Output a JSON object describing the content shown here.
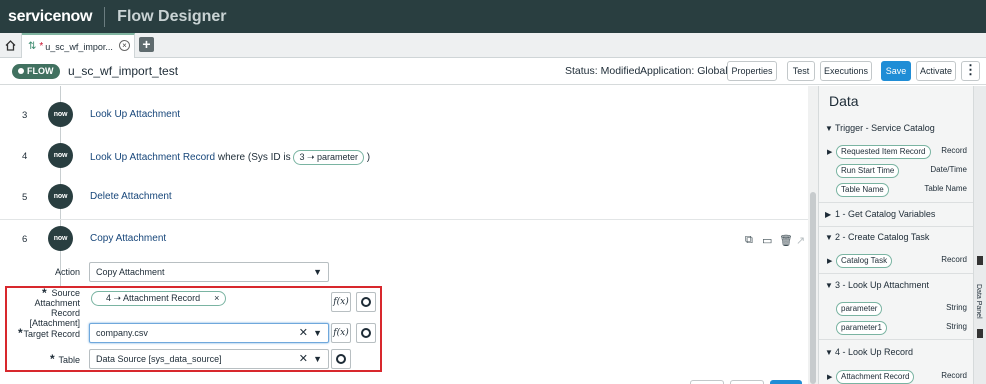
{
  "header": {
    "logo": "servicenow",
    "app_title": "Flow Designer"
  },
  "tabs": {
    "home_icon": "home-icon",
    "active_tab": {
      "label": "u_sc_wf_impor...",
      "dirty_marker": "*"
    }
  },
  "toolbar": {
    "badge": "FLOW",
    "flow_name": "u_sc_wf_import_test",
    "status": "Status: Modified",
    "application": "Application: Global",
    "buttons": {
      "properties": "Properties",
      "test": "Test",
      "executions": "Executions",
      "save": "Save",
      "activate": "Activate",
      "more": "⋮"
    }
  },
  "steps": [
    {
      "num": "3",
      "logo": "now",
      "label": "Look Up Attachment"
    },
    {
      "num": "4",
      "logo": "now",
      "label": "Look Up Attachment Record",
      "where": " where (Sys ID is ",
      "pill": "3 ➝ parameter",
      "close": " )"
    },
    {
      "num": "5",
      "logo": "now",
      "label": "Delete Attachment"
    },
    {
      "num": "6",
      "logo": "now",
      "label": "Copy Attachment"
    }
  ],
  "action_form": {
    "action_label": "Action",
    "action_value": "Copy Attachment",
    "source_label_1": "Source",
    "source_label_2": "Attachment",
    "source_label_3": "Record [Attachment]",
    "source_pill": "4 ➝ Attachment Record",
    "target_label": "Target Record",
    "target_value": "company.csv",
    "table_label": "Table",
    "table_value": "Data Source [sys_data_source]",
    "fx": "f(x)"
  },
  "data_panel": {
    "title": "Data",
    "sections": [
      {
        "label": "Trigger - Service Catalog",
        "expanded": true
      },
      {
        "label": "1 - Get Catalog Variables",
        "expanded": false
      },
      {
        "label": "2 - Create Catalog Task",
        "expanded": true
      },
      {
        "label": "3 - Look Up Attachment",
        "expanded": true
      },
      {
        "label": "4 - Look Up Record",
        "expanded": true
      }
    ],
    "pills": [
      {
        "label": "Requested Item Record",
        "type": "Record"
      },
      {
        "label": "Run Start Time",
        "type": "Date/Time"
      },
      {
        "label": "Table Name",
        "type": "Table Name"
      },
      {
        "label": "Catalog Task",
        "type": "Record"
      },
      {
        "label": "parameter",
        "type": "String"
      },
      {
        "label": "parameter1",
        "type": "String"
      },
      {
        "label": "Attachment Record",
        "type": "Record"
      }
    ],
    "rail_label": "Data Panel"
  },
  "colors": {
    "header_bg": "#293e40",
    "primary": "#1f8dd6",
    "pill_border": "#7ab4a2",
    "highlight": "#d8282d",
    "link": "#17467a"
  }
}
